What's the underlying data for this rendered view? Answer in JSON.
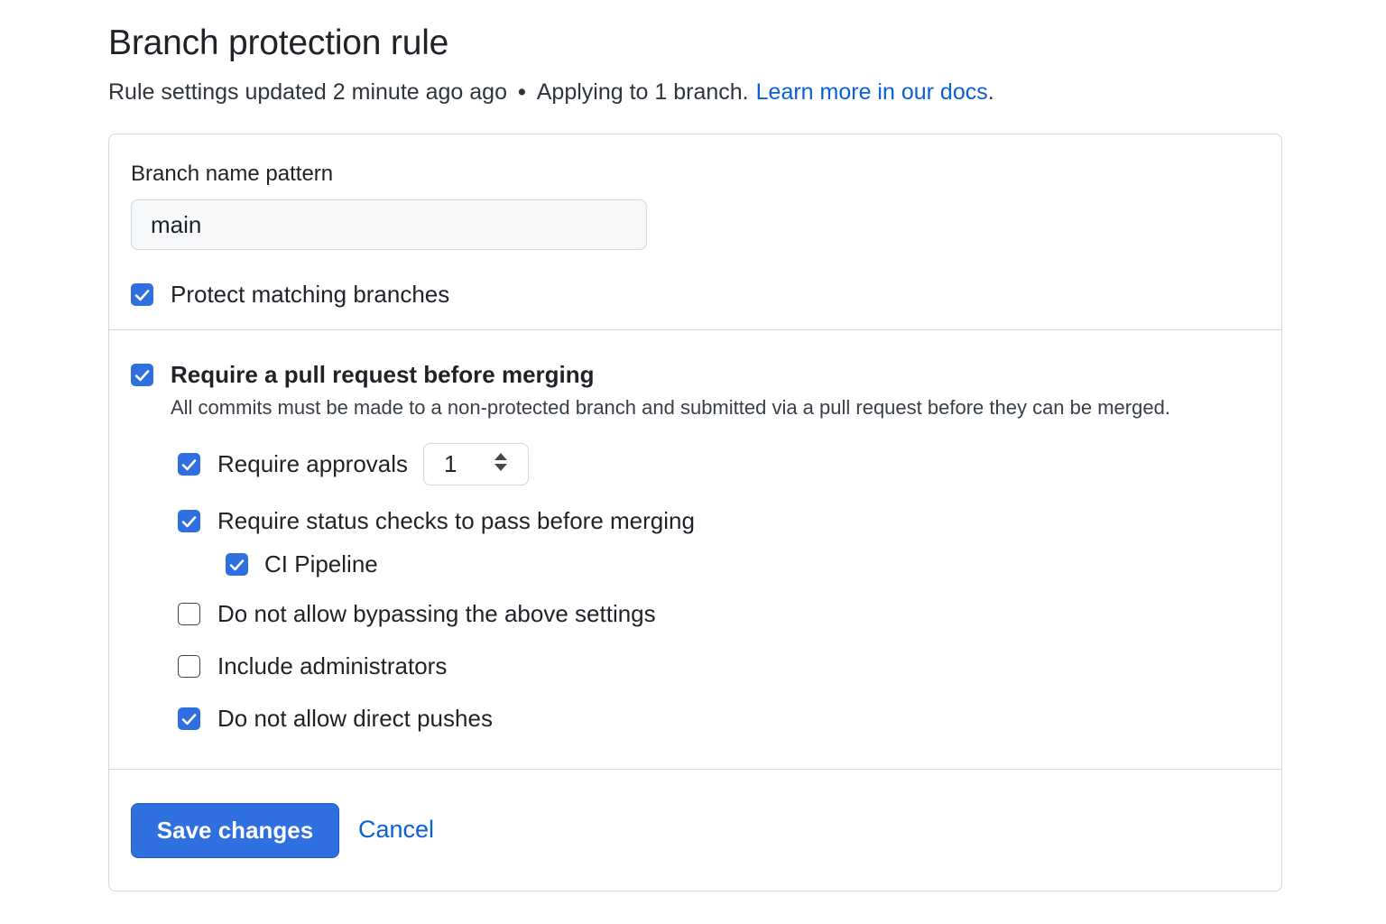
{
  "header": {
    "title": "Branch protection rule",
    "subtitle_prefix": "Rule settings updated 2 minute ago ago",
    "separator": "•",
    "subtitle_applying": "Applying to 1 branch.",
    "learn_more_link": "Learn more in our docs",
    "learn_more_suffix": "."
  },
  "branch_pattern": {
    "label": "Branch name pattern",
    "value": "main",
    "protect_matching": {
      "label": "Protect matching branches",
      "checked": true
    }
  },
  "rules": {
    "require_pr": {
      "label": "Require a pull request before merging",
      "checked": true,
      "description": "All commits must be made to a non-protected branch and submitted via a pull request before they can be merged."
    },
    "require_approvals": {
      "label": "Require approvals",
      "checked": true,
      "count": "1"
    },
    "require_status_checks": {
      "label": "Require status checks to pass before merging",
      "checked": true
    },
    "ci_pipeline": {
      "label": "CI Pipeline",
      "checked": true
    },
    "no_bypass": {
      "label": "Do not allow bypassing the above settings",
      "checked": false
    },
    "include_admins": {
      "label": "Include administrators",
      "checked": false
    },
    "no_direct_push": {
      "label": "Do not allow direct pushes",
      "checked": true
    }
  },
  "actions": {
    "save_label": "Save changes",
    "cancel_label": "Cancel"
  },
  "colors": {
    "accent": "#2f6fe0",
    "link": "#0b5fd7",
    "border": "#d0d7de"
  }
}
